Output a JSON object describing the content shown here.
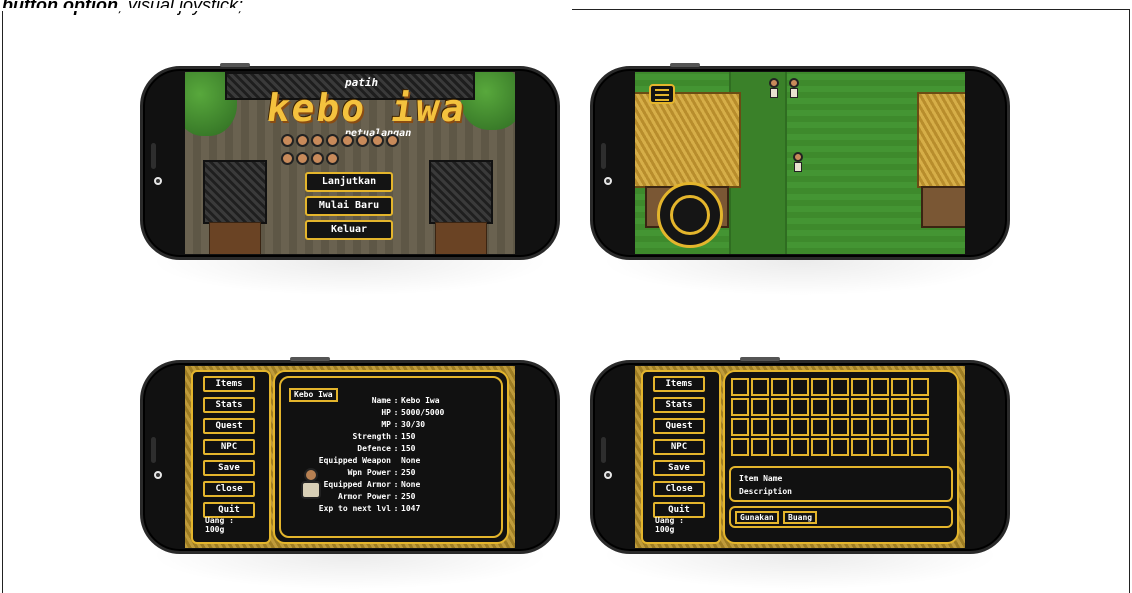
{
  "caption": {
    "bold": "button option",
    "plain": ", visual joystick;"
  },
  "title_screen": {
    "game_title": "kebo iwa",
    "title_prefix": "patih",
    "title_suffix": "petualangan",
    "menu": [
      "Lanjutkan",
      "Mulai Baru",
      "Keluar"
    ]
  },
  "stats_screen": {
    "side_menu": [
      "Items",
      "Stats",
      "Quest",
      "NPC",
      "Save",
      "Close",
      "Quit"
    ],
    "money_label": "Uang :",
    "money_value": "100g",
    "character_button": "Kebo Iwa",
    "stats": [
      {
        "key": "Name",
        "value": "Kebo Iwa"
      },
      {
        "key": "HP",
        "value": "5000/5000"
      },
      {
        "key": "MP",
        "value": "30/30"
      },
      {
        "key": "Strength",
        "value": "150"
      },
      {
        "key": "Defence",
        "value": "150"
      },
      {
        "key": "Equipped Weapon",
        "value": "None"
      },
      {
        "key": "Wpn Power",
        "value": "250"
      },
      {
        "key": "Equipped Armor",
        "value": "None"
      },
      {
        "key": "Armor Power",
        "value": "250"
      },
      {
        "key": "Exp to next lvl",
        "value": "1047"
      }
    ]
  },
  "items_screen": {
    "side_menu": [
      "Items",
      "Stats",
      "Quest",
      "NPC",
      "Save",
      "Close",
      "Quit"
    ],
    "money_label": "Uang :",
    "money_value": "100g",
    "item_name": "Item Name",
    "item_description": "Description",
    "actions": [
      "Gunakan",
      "Buang"
    ]
  },
  "colors": {
    "accent": "#e4b52c",
    "panel": "#111111"
  }
}
